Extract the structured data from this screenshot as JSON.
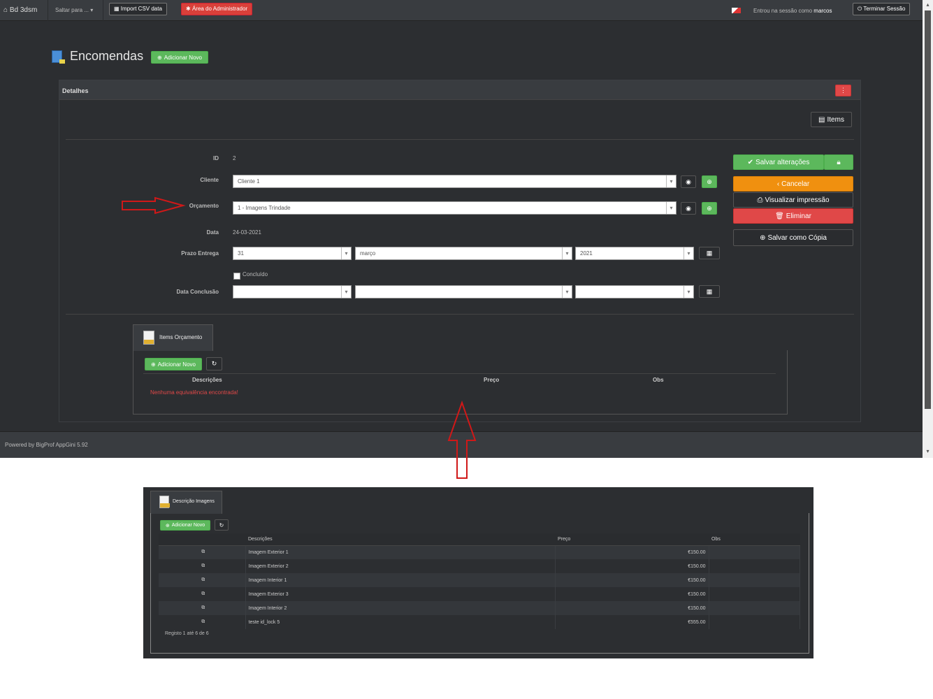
{
  "navbar": {
    "brand": "Bd 3dsm",
    "jump": "Saltar para ...",
    "import": "Import CSV data",
    "admin": "Área do Administrador",
    "session_prefix": "Entrou na sessão como",
    "user": "marcos",
    "logout": "Terminar Sessão"
  },
  "page": {
    "title": "Encomendas",
    "add_new": "Adicionar Novo"
  },
  "panel": {
    "title": "Detalhes",
    "items_button": "Items",
    "fields": {
      "id_label": "ID",
      "id_value": "2",
      "cliente_label": "Cliente",
      "cliente_value": "Cliente 1",
      "orcamento_label": "Orçamento",
      "orcamento_value": "1 - Imagens Trindade",
      "data_label": "Data",
      "data_value": "24-03-2021",
      "prazo_label": "Prazo Entrega",
      "prazo_day": "31",
      "prazo_month": "março",
      "prazo_year": "2021",
      "concluido_label": "Concluído",
      "conclusao_label": "Data Conclusão"
    },
    "actions": {
      "save": "Salvar alterações",
      "cancel": "Cancelar",
      "print": "Visualizar impressão",
      "delete": "Eliminar",
      "save_copy": "Salvar como Cópia"
    }
  },
  "child_tab": {
    "label": "Items Orçamento",
    "add_new": "Adicionar Novo",
    "col_desc": "Descrições",
    "col_price": "Preço",
    "col_obs": "Obs",
    "empty": "Nenhuma equivalência encontrada!"
  },
  "footer": {
    "powered": "Powered by BigProf AppGini 5.92"
  },
  "bottom": {
    "tab_label": "Descrição Imagens",
    "add_new": "Adicionar Novo",
    "col_desc": "Descrições",
    "col_price": "Preço",
    "col_obs": "Obs",
    "rows": [
      {
        "desc": "Imagem Exterior 1",
        "price": "€150.00",
        "obs": ""
      },
      {
        "desc": "Imagem Exterior 2",
        "price": "€150.00",
        "obs": ""
      },
      {
        "desc": "Imagem Interior 1",
        "price": "€150.00",
        "obs": ""
      },
      {
        "desc": "Imagem Exterior 3",
        "price": "€150.00",
        "obs": ""
      },
      {
        "desc": "Imagem Interior 2",
        "price": "€150.00",
        "obs": ""
      },
      {
        "desc": "teste id_lock 5",
        "price": "€555.00",
        "obs": ""
      }
    ],
    "records": "Registo 1 até 6 de 6"
  },
  "colors": {
    "accent_green": "#5cb85c",
    "accent_red": "#e04848",
    "accent_orange": "#f0900f",
    "annotation_red": "#d01818"
  }
}
